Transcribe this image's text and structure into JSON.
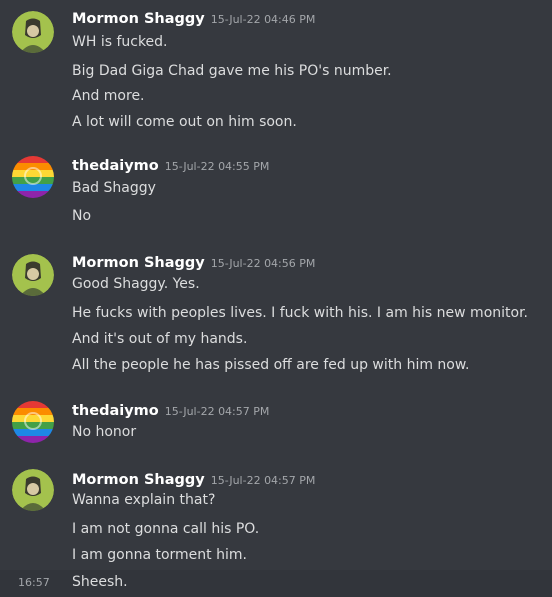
{
  "messages": [
    {
      "author": "Mormon Shaggy",
      "timestamp": "15-Jul-22 04:46 PM",
      "avatar_icon": "shaggy-avatar-icon",
      "lines": [
        "WH is fucked.",
        "Big Dad Giga Chad gave me his PO's number.",
        "And more.",
        "A lot will come out on him soon."
      ]
    },
    {
      "author": "thedaiymo",
      "timestamp": "15-Jul-22 04:55 PM",
      "avatar_icon": "rainbow-avatar-icon",
      "lines": [
        "Bad Shaggy",
        "No"
      ]
    },
    {
      "author": "Mormon Shaggy",
      "timestamp": "15-Jul-22 04:56 PM",
      "avatar_icon": "shaggy-avatar-icon",
      "lines": [
        "Good Shaggy. Yes.",
        "He fucks with peoples lives. I fuck with his. I am his new monitor.",
        "And it's out of my hands.",
        "All the people he has pissed off are fed up with him now."
      ]
    },
    {
      "author": "thedaiymo",
      "timestamp": "15-Jul-22 04:57 PM",
      "avatar_icon": "rainbow-avatar-icon",
      "lines": [
        "No honor"
      ]
    },
    {
      "author": "Mormon Shaggy",
      "timestamp": "15-Jul-22 04:57 PM",
      "avatar_icon": "shaggy-avatar-icon",
      "lines": [
        "Wanna explain that?",
        "I am not gonna call his PO.",
        "I am gonna torment him."
      ]
    }
  ],
  "continuation": {
    "time": "16:57",
    "text": "Sheesh."
  },
  "colors": {
    "background": "#36393f",
    "username": "#ffffff",
    "timestamp": "#a3a6aa",
    "text": "#dcddde",
    "hover_row": "#32353b"
  }
}
